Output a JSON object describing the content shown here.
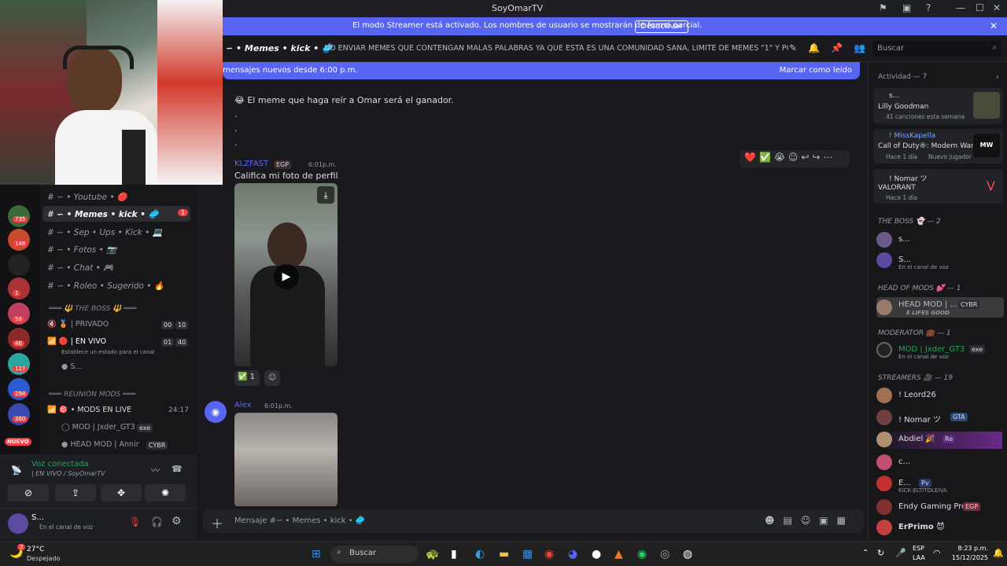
{
  "window": {
    "title": "SoyOmarTV"
  },
  "banner": {
    "message": "El modo Streamer está activado. Los nombres de usuario se mostrarán de forma parcial.",
    "button": "Desactivar"
  },
  "header": {
    "channel": "∽ • Memes • kick • 🥏",
    "topic": "NO ENVIAR MEMES QUE CONTENGAN MALAS PALABRAS YA QUE ESTA ES UNA COMUNIDAD SANA, LIMITE DE MEMES \"1\" Y POR ULTIMO E...",
    "search_placeholder": "Buscar"
  },
  "newbar": {
    "left": "mensajes nuevos desde 6:00 p.m.",
    "right": "Marcar como leído"
  },
  "chat": {
    "line1": "😂 El meme que haga reír a Omar será el ganador.",
    "dot": ".",
    "msg1": {
      "user": "KLZFAST",
      "tag": "EGP",
      "time": "6:01p.m.",
      "text": "Califica mi foto de perfil",
      "reaction_count": "1"
    },
    "msg2": {
      "user": "Alex",
      "time": "6:01p.m."
    },
    "composer_placeholder": "Mensaje #∽ • Memes • kick • 🥏"
  },
  "channels": {
    "items": [
      {
        "label": "∽ • Youtube • 🔴"
      },
      {
        "label": "∽ • Memes • kick • 🥏",
        "badge": "1"
      },
      {
        "label": "∽ • Sep • Ups • Kick • 💻"
      },
      {
        "label": "∽ • Fotos • 📷"
      },
      {
        "label": "∽ • Chat • 🎮"
      },
      {
        "label": "∽ • Roleo • Sugerido • 🔥"
      }
    ],
    "cat_boss": "═══ 🔱 THE BOSS 🔱 ═══",
    "privado": "| PRIVADO",
    "privado_counts": [
      "00",
      "10"
    ],
    "envivo": "| EN VIVO",
    "envivo_counts": [
      "01",
      "40"
    ],
    "envivo_status": "Establece un estado para el canal",
    "envivo_user": "S...",
    "cat_reunion": "═══ REUNION MODS ═══",
    "mods_live": "• MODS EN LIVE",
    "mods_time": "24:17",
    "mods_user1": "MOD | Jxder_GT3",
    "mods_user1_tag": "exe",
    "mods_user2": "HEAD MOD | Annir",
    "mods_user2_tag": "CYBR"
  },
  "servers": {
    "badges": [
      "735",
      "148",
      "1",
      "59",
      "46",
      "127",
      "294",
      "360"
    ],
    "new_label": "NUEVO"
  },
  "voice": {
    "status": "Voz conectada",
    "channel": "| EN VIVO / SoyOmarTV"
  },
  "user": {
    "name": "S...",
    "status": "En el canal de voz"
  },
  "activity": {
    "header": "Actividad — 7",
    "cards": [
      {
        "user": "s...",
        "title": "Lilly Goodman",
        "sub": "41 canciones esta semana"
      },
      {
        "user": "! MissKapella",
        "title": "Call of Duty®: Modern Warf...",
        "sub": "Hace 1 día",
        "extra": "Nuevo jugador"
      },
      {
        "user": "! Nomar ツ",
        "title": "VALORANT",
        "sub": "Hace 1 día"
      }
    ],
    "sec_boss": "THE BOSS 👻 — 2",
    "boss_members": [
      {
        "name": "s..."
      },
      {
        "name": "S...",
        "sub": "En el canal de voz"
      }
    ],
    "sec_head": "HEAD OF MODS 💕 — 1",
    "head_member": {
      "name": "HEAD MOD | ...",
      "tag": "CYBR",
      "sub": "E LIFES GOOD"
    },
    "sec_mod": "MODERATOR 💼 — 1",
    "mod_member": {
      "name": "MOD | Jxder_GT3",
      "tag": "exe",
      "sub": "En el canal de voz"
    },
    "sec_streamers": "STREAMERS 🎥 — 19",
    "streamers": [
      {
        "name": "! Leord26"
      },
      {
        "name": "! Nomar ツ",
        "tag": "GTA"
      },
      {
        "name": "Abdiel 🎉",
        "tag": "Re"
      },
      {
        "name": "c..."
      },
      {
        "name": "E...",
        "tag": "Pv",
        "sub": "KICK:ELTITOLEIVA"
      },
      {
        "name": "Endy Gaming Pro",
        "tag": "EGP"
      },
      {
        "name": "ErPrimo 😈"
      }
    ]
  },
  "taskbar": {
    "weather_temp": "27°C",
    "weather_desc": "Despejado",
    "weather_badge": "2",
    "search": "Buscar",
    "lang": "ESP",
    "lang2": "LAA",
    "time": "8:23 p.m.",
    "date": "15/12/2025"
  }
}
